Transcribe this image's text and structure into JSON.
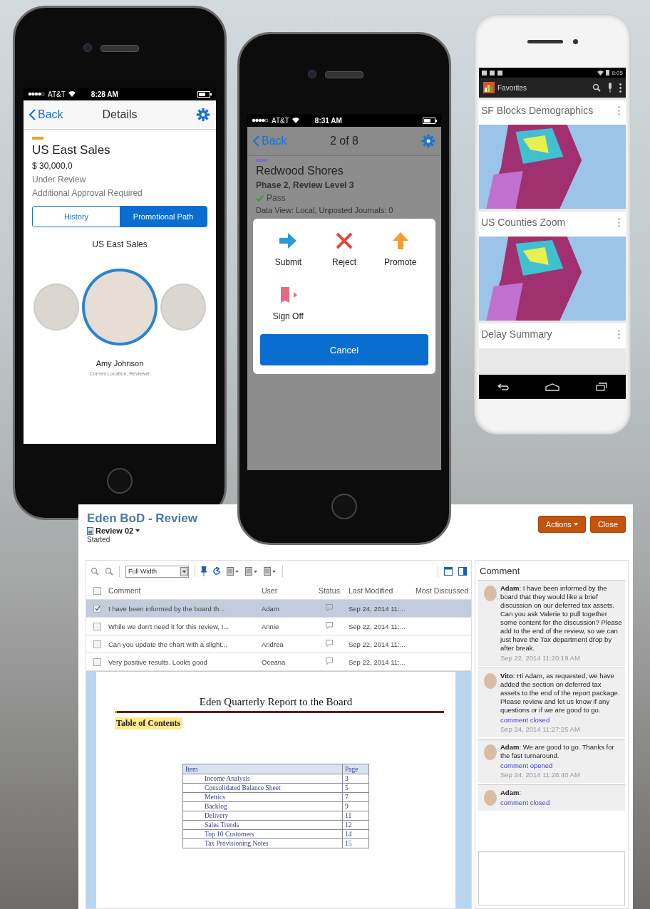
{
  "details_phone": {
    "status_bar": {
      "carrier": "AT&T",
      "time": "8:28 AM"
    },
    "nav": {
      "back": "Back",
      "title": "Details"
    },
    "title": "US East Sales",
    "amount": "$ 30,000.0",
    "status": "Under Review",
    "note": "Additional Approval Required",
    "tabs": [
      {
        "label": "History",
        "selected": false
      },
      {
        "label": "Promotional Path",
        "selected": true
      }
    ],
    "path_title": "US East Sales",
    "people": [
      {
        "selected": false
      },
      {
        "selected": true
      },
      {
        "selected": false
      }
    ],
    "person": {
      "name": "Amy Johnson",
      "location": "Current Location, Reviewer"
    }
  },
  "actions_phone": {
    "status_bar": {
      "carrier": "AT&T",
      "time": "8:31 AM"
    },
    "nav": {
      "back": "Back",
      "title": "2 of 8"
    },
    "title": "Redwood Shores",
    "phase": "Phase 2, Review Level 3",
    "result": "Pass",
    "data_view": "Data View: Local, Unposted Journals: 0",
    "actions": [
      {
        "kind": "submit",
        "label": "Submit"
      },
      {
        "kind": "reject",
        "label": "Reject"
      },
      {
        "kind": "promote",
        "label": "Promote"
      },
      {
        "kind": "signoff",
        "label": "Sign Off"
      }
    ],
    "cancel": "Cancel"
  },
  "favorites_phone": {
    "status_bar": {
      "time": "8:05"
    },
    "title": "Favorites",
    "cards": [
      {
        "title": "SF Blocks Demographics",
        "preview": true
      },
      {
        "title": "US Counties Zoom",
        "preview": true
      },
      {
        "title": "Delay Summary",
        "preview": false
      }
    ]
  },
  "review_window": {
    "title": "Eden BoD - Review",
    "version": "Review 02",
    "state": "Started",
    "buttons": [
      "Actions",
      "Close"
    ],
    "toolbar": {
      "zoom": "Full Width"
    },
    "all_checked": false,
    "columns": [
      "Comment",
      "User",
      "Status",
      "Last Modified",
      "Most Discussed"
    ],
    "rows": [
      {
        "comment": "I have been informed by the board th...",
        "user": "Adam",
        "modified": "Sep 24, 2014 11:...",
        "checked": true,
        "selected": true
      },
      {
        "comment": "While we don't need it for this review, I...",
        "user": "Annie",
        "modified": "Sep 22, 2014 11:...",
        "checked": false,
        "selected": false
      },
      {
        "comment": "Can you update the chart with a slight...",
        "user": "Andrea",
        "modified": "Sep 22, 2014 11:...",
        "checked": false,
        "selected": false
      },
      {
        "comment": "Very positive results.  Looks good",
        "user": "Oceana",
        "modified": "Sep 22, 2014 11:...",
        "checked": false,
        "selected": false
      }
    ],
    "document": {
      "title": "Eden Quarterly Report to the Board",
      "heading": "Table of Contents",
      "toc_columns": [
        "Item",
        "Page"
      ],
      "toc": [
        {
          "item": "Income Analysis",
          "page": "3"
        },
        {
          "item": "Consolidated Balance Sheet",
          "page": "5"
        },
        {
          "item": "Metrics",
          "page": "7"
        },
        {
          "item": "Backlog",
          "page": "9"
        },
        {
          "item": "Delivery",
          "page": "11"
        },
        {
          "item": "Sales Trends",
          "page": "12"
        },
        {
          "item": "Top 10 Customers",
          "page": "14"
        },
        {
          "item": "Tax Provisioning Notes",
          "page": "15"
        }
      ]
    },
    "comments_panel": {
      "title": "Comment",
      "comments": [
        {
          "text": "**Adam**: I have been informed by the board that they would like a brief discussion on our deferred tax assets. Can you ask Valerie to pull together some content for the discussion?  Please add to the end of the review, so we can just have the Tax department drop by after break.",
          "date": "Sep 22, 2014 11:20:19 AM"
        },
        {
          "text": "**Vito**: Hi Adam, as requested, we have added the section on deferred tax assets to the end of the report package.  Please review and let us know if any questions or if we are good to go.",
          "status": "comment closed",
          "date": "Sep 24, 2014 11:27:25 AM"
        },
        {
          "text": "**Adam**: We are good to go. Thanks for the fast turnaround.",
          "status": "comment opened",
          "date": "Sep 24, 2014 11:28:40 AM"
        },
        {
          "text": "**Adam**:",
          "status": "comment closed"
        }
      ]
    }
  }
}
